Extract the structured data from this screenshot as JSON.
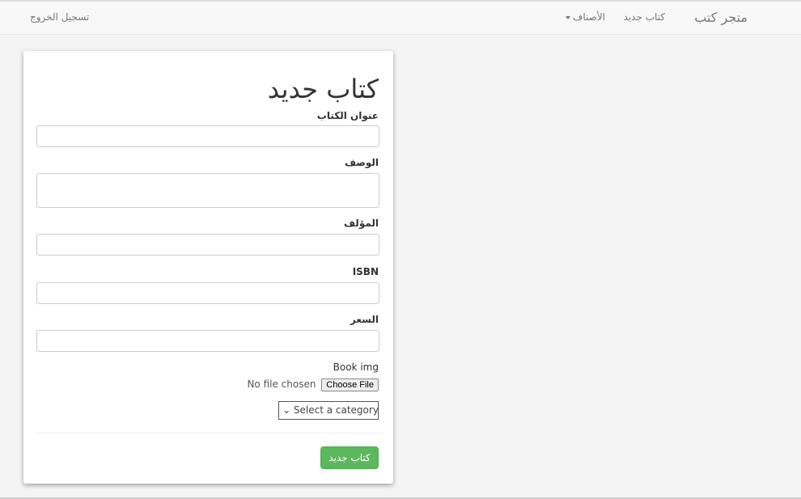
{
  "navbar": {
    "brand": "متجر كتب",
    "new_book": "كتاب جديد",
    "categories": "الأصناف",
    "logout": "تسجيل الخروج"
  },
  "form": {
    "title": "كتاب جديد",
    "fields": {
      "book_title": "عنوان الكتاب",
      "description": "الوصف",
      "author": "المؤلف",
      "isbn": "ISBN",
      "price": "السعر",
      "image": "Book img"
    },
    "file_status": "No file chosen",
    "file_button": "Choose File",
    "category_placeholder": "Select a category",
    "submit": "كتاب جديد"
  },
  "colors": {
    "submit": "#5cb85c"
  }
}
